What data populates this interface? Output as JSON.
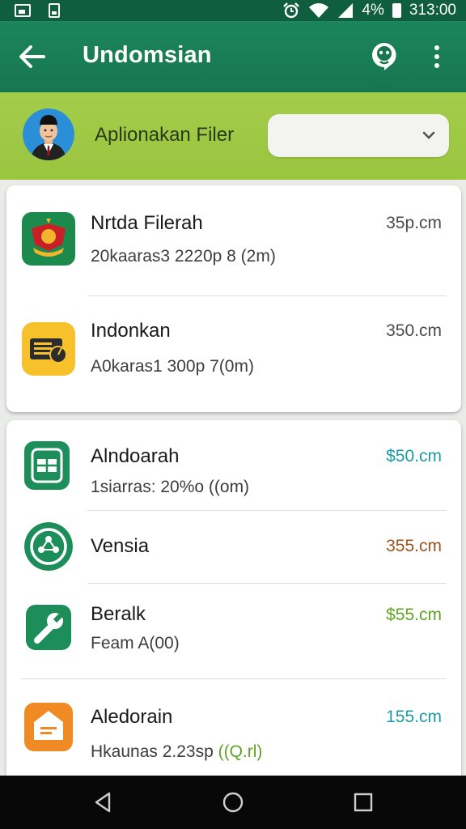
{
  "status_bar": {
    "battery_percent": "4%",
    "time": "313:00"
  },
  "app_bar": {
    "title": "Undomsian"
  },
  "filter": {
    "label": "Aplionakan Filer",
    "dropdown_value": ""
  },
  "card1": {
    "items": [
      {
        "title": "Nrtda Filerah",
        "subtitle": "20kaaras3 2220p 8 (2m)",
        "price": "35p.cm",
        "price_color": "#4a4a4a",
        "icon": "indonesia-emblem-icon"
      },
      {
        "title": "Indonkan",
        "subtitle": "A0karas1 300p 7(0m)",
        "price": "350.cm",
        "price_color": "#4a4a4a",
        "icon": "radio-icon"
      }
    ]
  },
  "card2": {
    "items": [
      {
        "title": "Alndoarah",
        "subtitle": "1siarras: 20%o ((om)",
        "price": "$50.cm",
        "price_color": "#1e9aa6",
        "icon": "spreadsheet-icon"
      },
      {
        "title": "Vensia",
        "subtitle": "",
        "price": "355.cm",
        "price_color": "#a0521c",
        "icon": "network-icon"
      },
      {
        "title": "Beralk",
        "subtitle": "Feam A(00)",
        "price": "$55.cm",
        "price_color": "#5fa325",
        "icon": "wrench-icon"
      },
      {
        "title": "Aledorain",
        "subtitle_prefix": "Hkaunas 2.23sp ",
        "subtitle_highlight": "((Q.rl)",
        "price": "155.cm",
        "price_color": "#1e9aa6",
        "highlight_color": "#5fa325",
        "icon": "house-icon"
      }
    ]
  },
  "nav": {
    "back": "back-icon",
    "home": "home-icon",
    "recents": "recents-icon"
  }
}
